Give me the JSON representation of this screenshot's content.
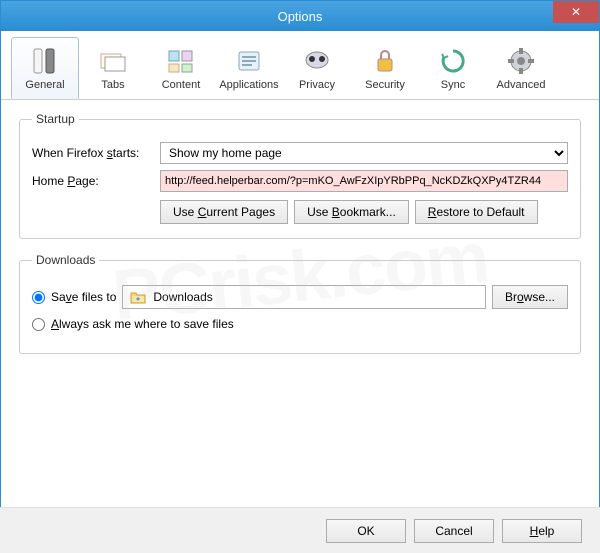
{
  "window": {
    "title": "Options"
  },
  "toolbar": {
    "items": [
      {
        "label": "General"
      },
      {
        "label": "Tabs"
      },
      {
        "label": "Content"
      },
      {
        "label": "Applications"
      },
      {
        "label": "Privacy"
      },
      {
        "label": "Security"
      },
      {
        "label": "Sync"
      },
      {
        "label": "Advanced"
      }
    ]
  },
  "startup": {
    "legend": "Startup",
    "when_label_pre": "When Firefox ",
    "when_label_u": "s",
    "when_label_post": "tarts:",
    "when_value": "Show my home page",
    "home_label_pre": "Home ",
    "home_label_u": "P",
    "home_label_post": "age:",
    "home_value": "http://feed.helperbar.com/?p=mKO_AwFzXIpYRbPPq_NcKDZkQXPy4TZR44",
    "btn_current_pre": "Use ",
    "btn_current_u": "C",
    "btn_current_post": "urrent Pages",
    "btn_bookmark_pre": "Use ",
    "btn_bookmark_u": "B",
    "btn_bookmark_post": "ookmark...",
    "btn_restore_u": "R",
    "btn_restore_post": "estore to Default"
  },
  "downloads": {
    "legend": "Downloads",
    "save_label_pre": "Sa",
    "save_label_u": "v",
    "save_label_post": "e files to",
    "folder": "Downloads",
    "browse_pre": "Br",
    "browse_u": "o",
    "browse_post": "wse...",
    "always_pre": "",
    "always_u": "A",
    "always_post": "lways ask me where to save files"
  },
  "footer": {
    "ok": "OK",
    "cancel": "Cancel",
    "help_u": "H",
    "help_post": "elp"
  }
}
